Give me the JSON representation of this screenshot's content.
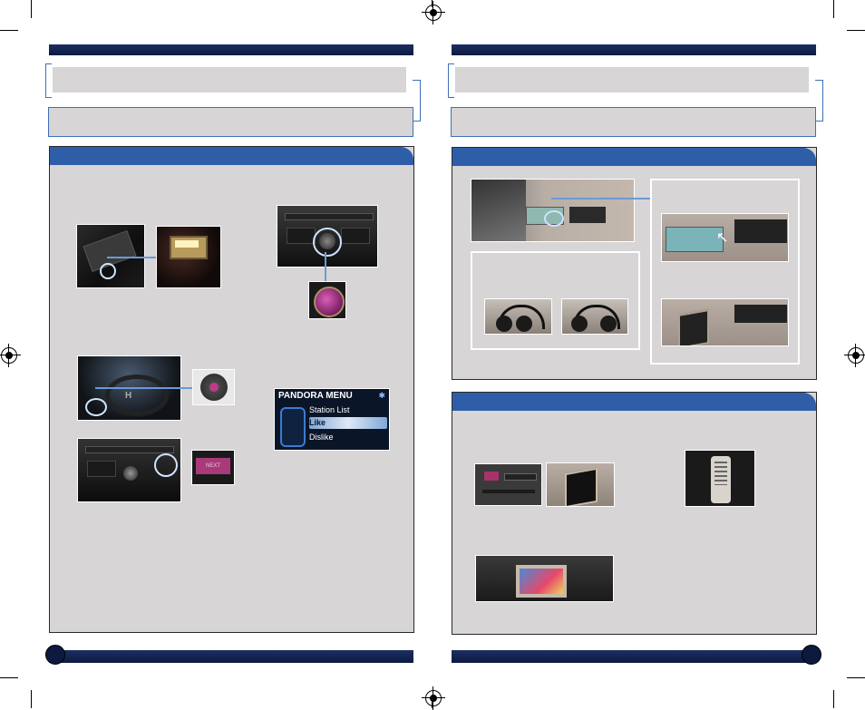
{
  "left_page": {
    "pandora_display": {
      "title": "PANDORA MENU",
      "items": [
        "Station List",
        "Like",
        "Dislike"
      ]
    },
    "button_label": "NEXT"
  },
  "icons": {
    "arrow": "arrow-pointer-icon",
    "bluetooth": "bluetooth-icon"
  },
  "colors": {
    "header_blue": "#2e5ea8",
    "navy_bar": "#0c1a40",
    "panel_gray": "#d7d5d6",
    "accent_blue": "#3f70b6"
  }
}
